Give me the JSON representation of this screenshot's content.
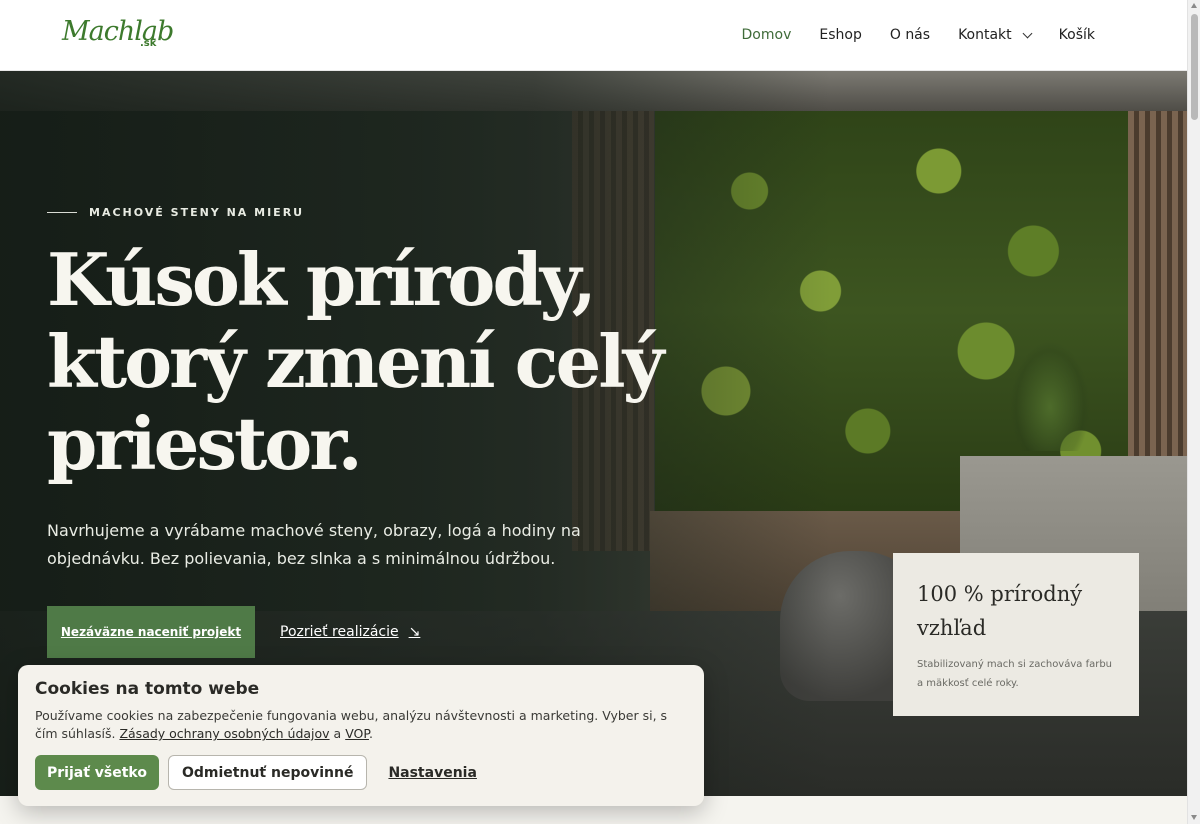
{
  "header": {
    "logo": {
      "main": "Machlab",
      "tld": ".sk"
    },
    "nav": [
      {
        "label": "Domov",
        "active": true
      },
      {
        "label": "Eshop"
      },
      {
        "label": "O nás"
      },
      {
        "label": "Kontakt",
        "has_dropdown": true
      },
      {
        "label": "Košík"
      }
    ]
  },
  "hero": {
    "eyebrow": "MACHOVÉ STENY NA MIERU",
    "headline_lines": [
      "Kúsok prírody,",
      "ktorý zmení celý",
      "priestor."
    ],
    "lead": "Navrhujeme a vyrábame machové steny, obrazy, logá a hodiny na objednávku. Bez polievania, bez slnka a s minimálnou údržbou.",
    "cta_primary": "Nezáväzne naceniť projekt",
    "cta_secondary": "Pozrieť realizácie",
    "cta_secondary_icon": "arrow-down-right-icon",
    "feature_card": {
      "title": "100 % prírodný vzhľad",
      "text": "Stabilizovaný mach si zachováva farbu a mäkkosť celé roky."
    }
  },
  "cookie_banner": {
    "title": "Cookies na tomto webe",
    "text_before": "Používame cookies na zabezpečenie fungovania webu, analýzu návštevnosti a marketing. Vyber si, s čím súhlasíš.",
    "privacy_link": "Zásady ochrany osobných údajov",
    "conjunction": "a",
    "terms_link": "VOP",
    "period": ".",
    "accept_label": "Prijať všetko",
    "reject_label": "Odmietnuť nepovinné",
    "settings_label": "Nastavenia"
  },
  "colors": {
    "accent": "#4f7a47",
    "accept_button": "#5d8a4c",
    "active_nav": "#3f6b39",
    "card_bg": "#eceae3",
    "banner_bg": "#f4f2ec"
  }
}
